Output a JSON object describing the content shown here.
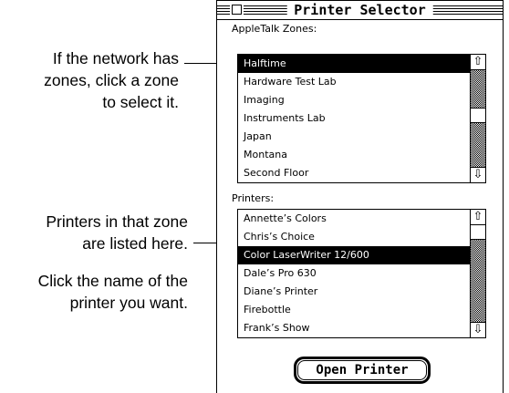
{
  "callouts": {
    "zones": [
      "If the network has",
      "zones, click a zone",
      "to select it."
    ],
    "printers_in_zone": [
      "Printers in that zone",
      "are listed here."
    ],
    "click_name": [
      "Click the name of the",
      "printer you want."
    ]
  },
  "window": {
    "title": "Printer Selector"
  },
  "zones": {
    "label": "AppleTalk Zones:",
    "items": [
      "Halftime",
      "Hardware Test Lab",
      "Imaging",
      "Instruments Lab",
      "Japan",
      "Montana",
      "Second Floor"
    ],
    "selected": "Halftime"
  },
  "printers": {
    "label": "Printers:",
    "items": [
      "Annette’s Colors",
      "Chris’s Choice",
      "Color LaserWriter 12/600",
      "Dale’s Pro 630",
      "Diane’s Printer",
      "Firebottle",
      "Frank’s Show"
    ],
    "selected": "Color LaserWriter 12/600"
  },
  "open_button": {
    "label": "Open Printer"
  },
  "icons": {
    "up_arrow": "⇧",
    "down_arrow": "⇩"
  }
}
